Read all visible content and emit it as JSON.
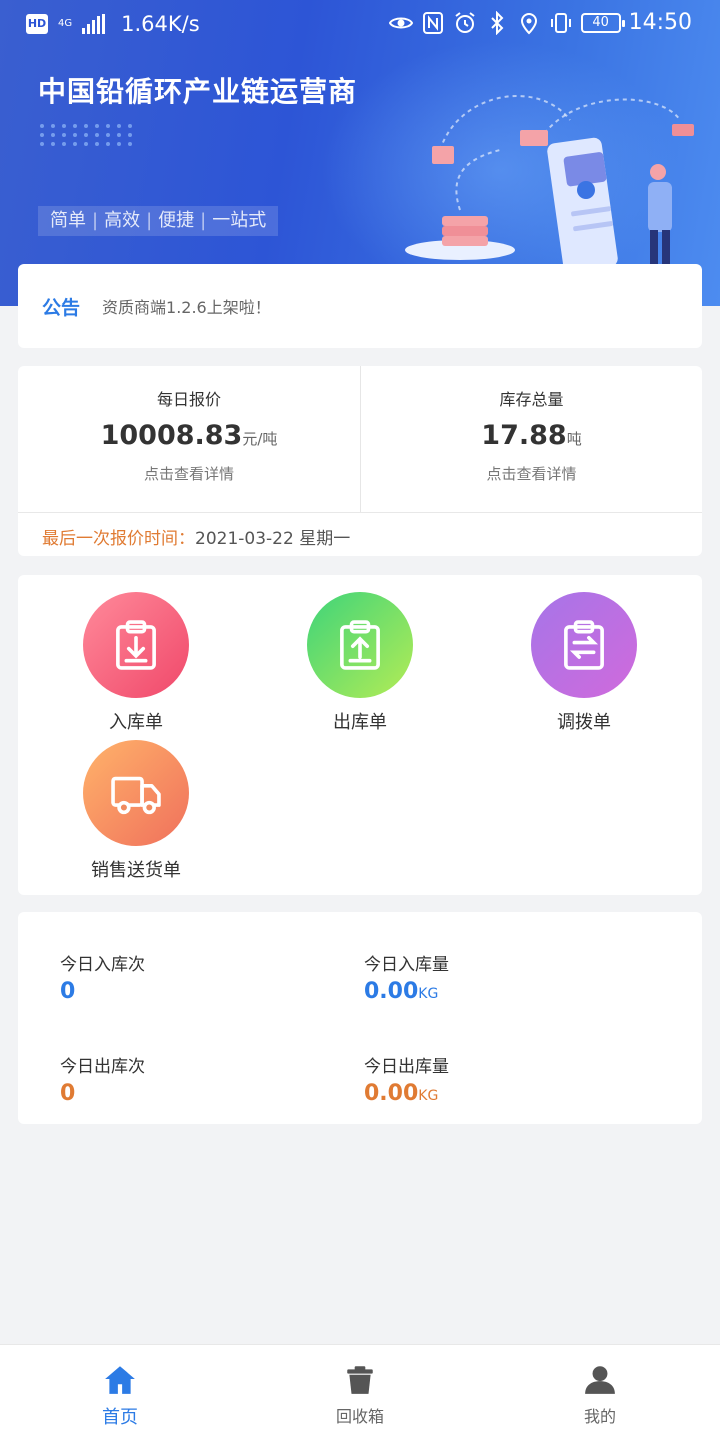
{
  "status_bar": {
    "network": "4G",
    "speed": "1.64K/s",
    "battery": "40",
    "time": "14:50",
    "icons": [
      "hd-icon",
      "signal-icon",
      "eye-icon",
      "nfc-icon",
      "alarm-icon",
      "bluetooth-icon",
      "location-icon",
      "vibrate-icon",
      "battery-icon"
    ]
  },
  "banner": {
    "title": "中国铅循环产业链运营商",
    "slogan": [
      "简单",
      "高效",
      "便捷",
      "一站式"
    ],
    "slogan_sep": "|",
    "accent": "#2d55d6"
  },
  "notice": {
    "tag": "公告",
    "text": "资质商端1.2.6上架啦！"
  },
  "stats": {
    "daily_price": {
      "label": "每日报价",
      "value": "10008.83",
      "unit": "元/吨",
      "link": "点击查看详情"
    },
    "inventory": {
      "label": "库存总量",
      "value": "17.88",
      "unit": "吨",
      "link": "点击查看详情"
    },
    "last_quote_label": "最后一次报价时间：",
    "last_quote_value": "2021-03-22 星期一"
  },
  "actions": [
    {
      "label": "入库单",
      "icon": "clipboard-download-icon",
      "colors": [
        "#ff8a9a",
        "#f0486a"
      ]
    },
    {
      "label": "出库单",
      "icon": "clipboard-upload-icon",
      "colors": [
        "#3ed47a",
        "#b4ec55"
      ]
    },
    {
      "label": "调拨单",
      "icon": "clipboard-transfer-icon",
      "colors": [
        "#a675e8",
        "#d06adc"
      ]
    },
    {
      "label": "销售送货单",
      "icon": "truck-icon",
      "colors": [
        "#ffb36a",
        "#f0705c"
      ]
    }
  ],
  "today": {
    "in_count_label": "今日入库次",
    "in_count_value": "0",
    "in_weight_label": "今日入库量",
    "in_weight_value": "0.00",
    "in_weight_unit": "KG",
    "out_count_label": "今日出库次",
    "out_count_value": "0",
    "out_weight_label": "今日出库量",
    "out_weight_value": "0.00",
    "out_weight_unit": "KG"
  },
  "tabbar": {
    "tabs": [
      {
        "label": "首页",
        "icon": "home-icon",
        "active": true
      },
      {
        "label": "回收箱",
        "icon": "trash-bin-icon",
        "active": false
      },
      {
        "label": "我的",
        "icon": "user-icon",
        "active": false
      }
    ],
    "active_color": "#2c7be5"
  }
}
